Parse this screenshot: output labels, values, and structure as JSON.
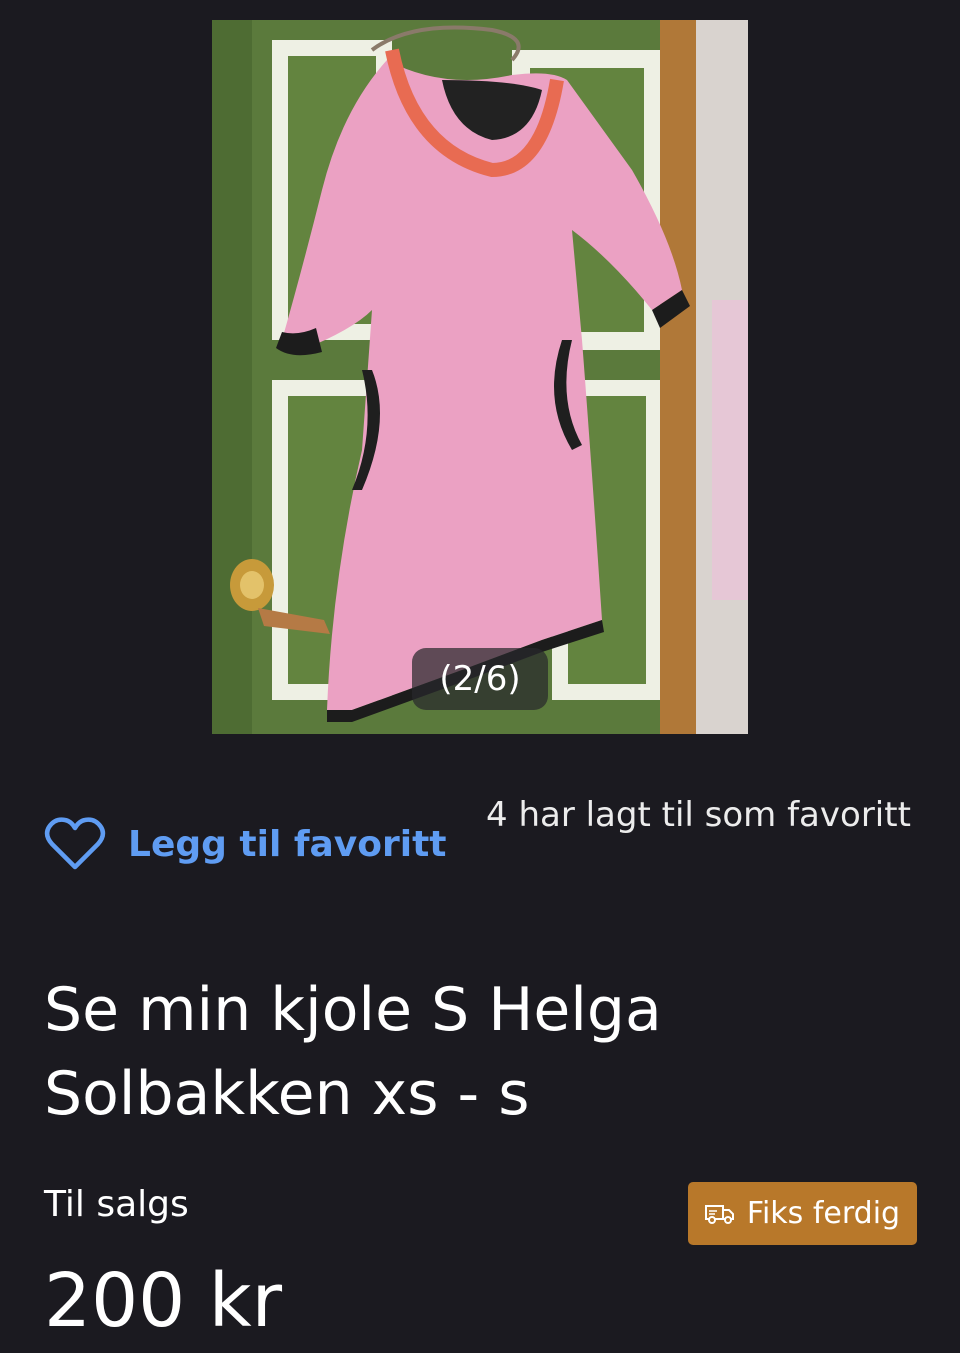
{
  "gallery": {
    "counter": "(2/6)",
    "current_index": 2,
    "total": 6,
    "image_description_icon": "photo-icon"
  },
  "favorite": {
    "label": "Legg til favoritt",
    "icon": "heart-outline-icon",
    "count_text": "4 har lagt til som favoritt"
  },
  "listing": {
    "title": "Se min kjole S Helga Solbakken xs - s",
    "status": "Til salgs",
    "price": "200 kr"
  },
  "shipping": {
    "button_label": "Fiks ferdig",
    "icon": "truck-icon"
  },
  "colors": {
    "background": "#1b1a20",
    "link_blue": "#5f9cf2",
    "fiks_ferdig": "#b8782a"
  }
}
